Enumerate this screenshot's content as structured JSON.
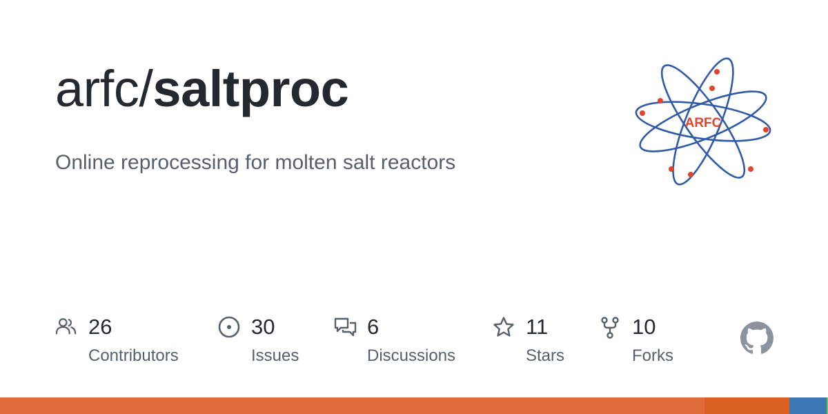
{
  "repo": {
    "owner": "arfc",
    "separator": "/",
    "name": "saltproc",
    "description": "Online reprocessing for molten salt reactors"
  },
  "logo": {
    "text": "ARFC",
    "orbit_color": "#2f5aa8",
    "electron_color": "#e0452b",
    "text_color": "#e0452b"
  },
  "stats": [
    {
      "icon": "people-icon",
      "value": "26",
      "label": "Contributors"
    },
    {
      "icon": "issue-circle-icon",
      "value": "30",
      "label": "Issues"
    },
    {
      "icon": "discussion-bubbles-icon",
      "value": "6",
      "label": "Discussions"
    },
    {
      "icon": "star-icon",
      "value": "11",
      "label": "Stars"
    },
    {
      "icon": "fork-icon",
      "value": "10",
      "label": "Forks"
    }
  ],
  "github_mark": {
    "icon": "github-octocat-icon",
    "color": "#8b949e"
  },
  "language_bar": [
    {
      "color": "#e06c3c",
      "fraction": 0.851
    },
    {
      "color": "#d9601f",
      "fraction": 0.102
    },
    {
      "color": "#3d77b4",
      "fraction": 0.045
    },
    {
      "color": "#6cc644",
      "fraction": 0.002
    }
  ],
  "colors": {
    "text_primary": "#24292f",
    "text_secondary": "#57606a",
    "icon_gray": "#57606a"
  }
}
